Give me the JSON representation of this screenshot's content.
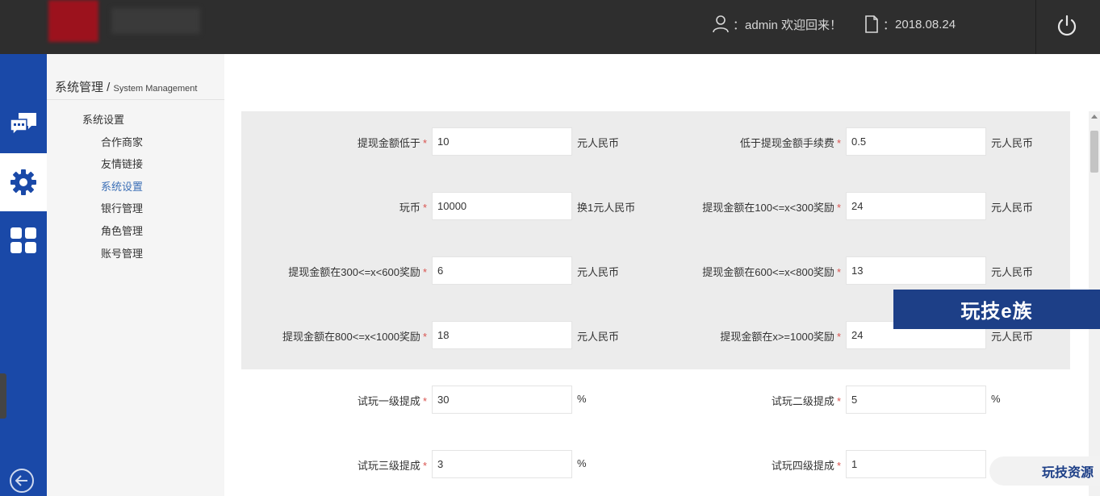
{
  "header": {
    "user_text": "admin 欢迎回来！",
    "user_prefix": "：",
    "date_prefix": "：",
    "date": "2018.08.24"
  },
  "leftbar": {
    "items": [
      {
        "icon": "chat-bubbles-icon"
      },
      {
        "icon": "gear-icon",
        "active": true
      },
      {
        "icon": "grid-icon"
      }
    ]
  },
  "subnav": {
    "title_cn": "系统管理",
    "title_sep": " / ",
    "title_en": "System Management",
    "group": "系统设置",
    "items": [
      {
        "label": "合作商家"
      },
      {
        "label": "友情链接"
      },
      {
        "label": "系统设置",
        "active": true
      },
      {
        "label": "银行管理"
      },
      {
        "label": "角色管理"
      },
      {
        "label": "账号管理"
      }
    ]
  },
  "form": {
    "required_mark": "*",
    "rows": [
      {
        "left": {
          "label": "提现金额低于",
          "value": "10",
          "unit": "元人民币"
        },
        "right": {
          "label": "低于提现金额手续费",
          "value": "0.5",
          "unit": "元人民币"
        }
      },
      {
        "left": {
          "label": "玩币",
          "value": "10000",
          "unit": "换1元人民币"
        },
        "right": {
          "label": "提现金额在100<=x<300奖励",
          "value": "24",
          "unit": "元人民币"
        }
      },
      {
        "left": {
          "label": "提现金额在300<=x<600奖励",
          "value": "6",
          "unit": "元人民币"
        },
        "right": {
          "label": "提现金额在600<=x<800奖励",
          "value": "13",
          "unit": "元人民币"
        }
      },
      {
        "left": {
          "label": "提现金额在800<=x<1000奖励",
          "value": "18",
          "unit": "元人民币"
        },
        "right": {
          "label": "提现金额在x>=1000奖励",
          "value": "24",
          "unit": "元人民币"
        }
      },
      {
        "left": {
          "label": "试玩一级提成",
          "value": "30",
          "unit": "%"
        },
        "right": {
          "label": "试玩二级提成",
          "value": "5",
          "unit": "%"
        }
      },
      {
        "left": {
          "label": "试玩三级提成",
          "value": "3",
          "unit": "%"
        },
        "right": {
          "label": "试玩四级提成",
          "value": "1",
          "unit": ""
        }
      }
    ]
  },
  "watermarks": {
    "banner": "玩技e族",
    "corner": "玩技资源"
  }
}
